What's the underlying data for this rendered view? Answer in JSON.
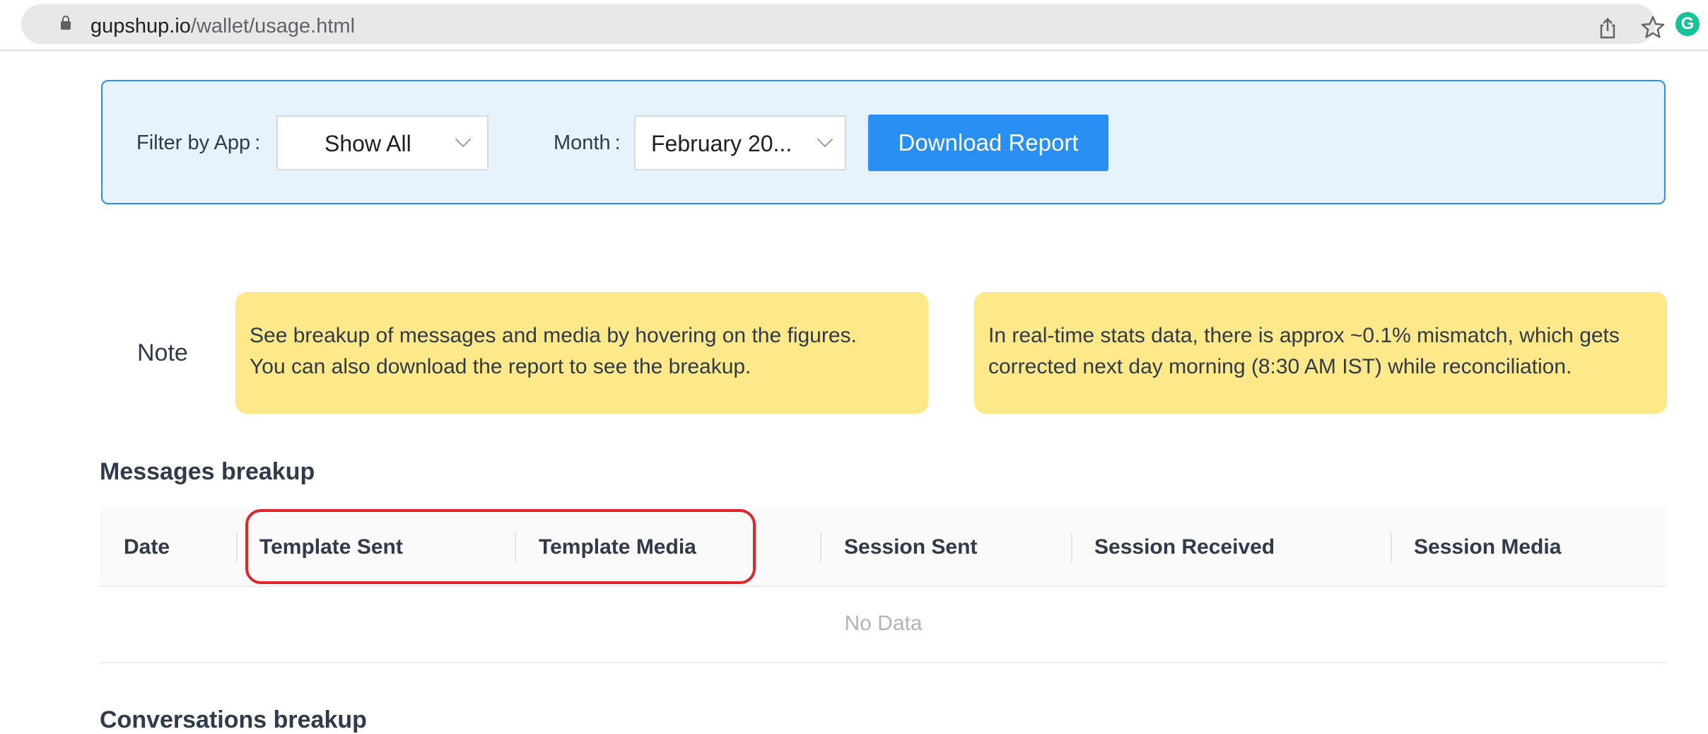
{
  "browser": {
    "url_host": "gupshup.io",
    "url_path": "/wallet/usage.html",
    "icons": [
      "lock-icon",
      "share-icon",
      "bookmark-star-icon",
      "grammarly-extension-icon"
    ],
    "extension_letter": "G"
  },
  "filters": {
    "app_label": "Filter by App",
    "app_value": "Show All",
    "month_label": "Month",
    "month_value": "February 20...",
    "separator": ":",
    "download_label": "Download Report"
  },
  "notes": {
    "label": "Note",
    "box1": [
      "See breakup of messages and media by hovering on the figures.",
      "You can also download the report to see the breakup."
    ],
    "box2": [
      "In real-time stats data, there is approx ~0.1% mismatch, which gets",
      "corrected next day morning (8:30 AM IST) while reconciliation."
    ]
  },
  "messages": {
    "title": "Messages breakup",
    "columns": [
      "Date",
      "Template Sent",
      "Template Media",
      "Session Sent",
      "Session Received",
      "Session Media"
    ],
    "empty_text": "No Data"
  },
  "next_section": {
    "title": "Conversations breakup"
  },
  "colors": {
    "accent": "#2a8ff3",
    "panel_bg": "#e6f2fc",
    "note_bg": "#fde88a",
    "highlight": "#e0262a"
  }
}
